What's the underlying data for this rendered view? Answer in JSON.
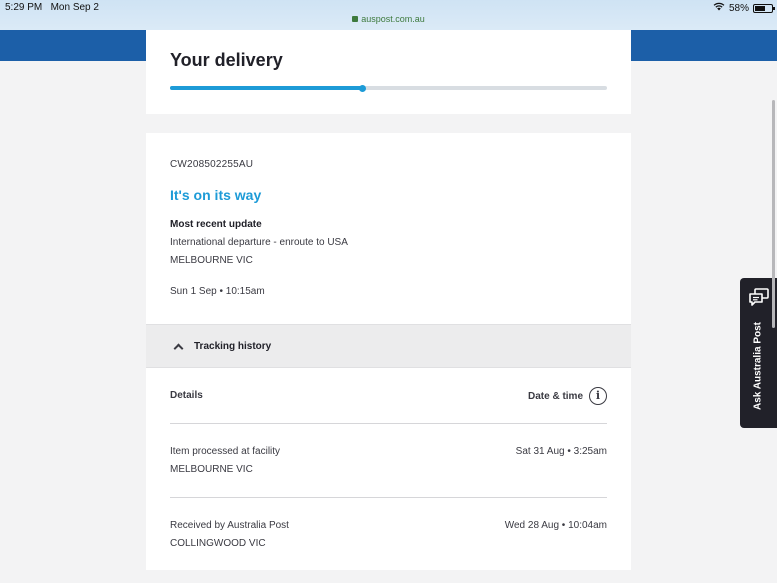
{
  "status_bar": {
    "time": "5:29 PM",
    "date": "Mon Sep 2",
    "url": "auspost.com.au",
    "battery": "58%"
  },
  "delivery": {
    "title": "Your delivery",
    "progress_fraction": 0.44
  },
  "tracking": {
    "number": "CW208502255AU",
    "status_heading": "It's on its way",
    "recent_label": "Most recent update",
    "recent_description": "International departure - enroute to USA",
    "recent_location": "MELBOURNE VIC",
    "recent_time": "Sun 1 Sep • 10:15am",
    "history_label": "Tracking history",
    "col_details": "Details",
    "col_date": "Date & time",
    "events": [
      {
        "description": "Item processed at facility",
        "location": "MELBOURNE VIC",
        "time": "Sat 31 Aug • 3:25am"
      },
      {
        "description": "Received by Australia Post",
        "location": "COLLINGWOOD VIC",
        "time": "Wed 28 Aug • 10:04am"
      }
    ]
  },
  "side_tab": {
    "label": "Ask Australia Post"
  },
  "colors": {
    "brand_blue": "#1c5fa8",
    "accent": "#1d9bd7",
    "dark": "#212129"
  }
}
